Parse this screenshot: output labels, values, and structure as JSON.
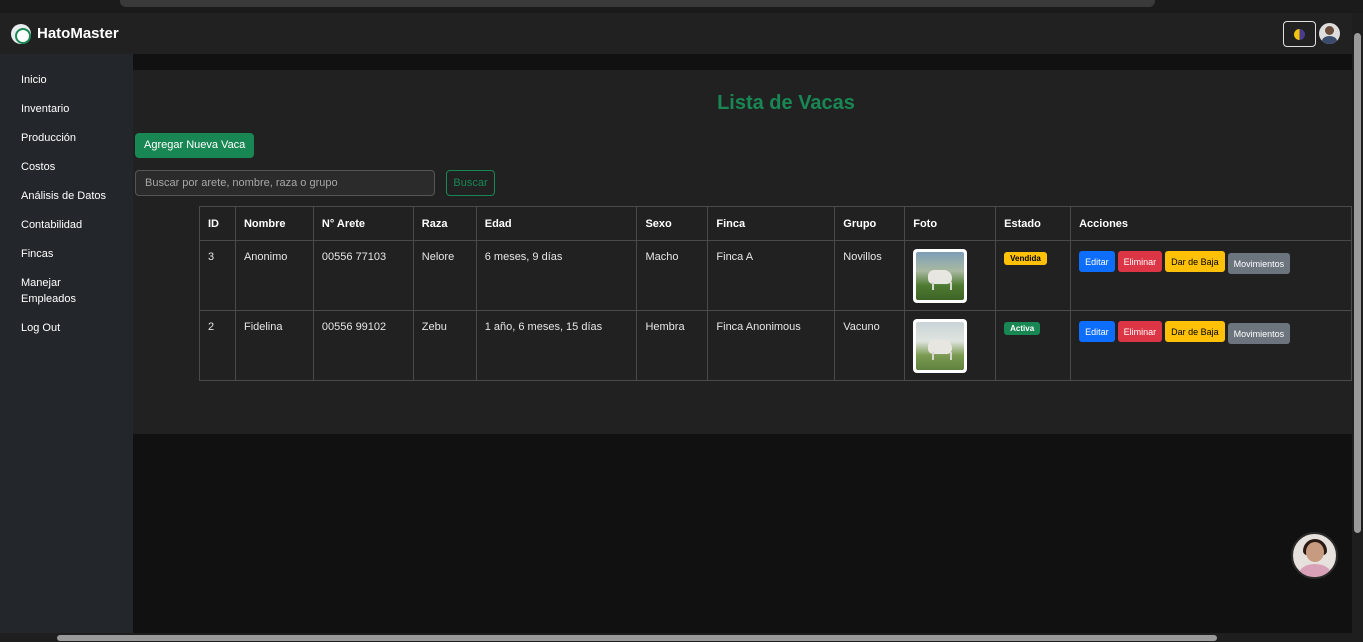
{
  "app": {
    "name": "HatoMaster",
    "accent": "#198754"
  },
  "sidebar": {
    "items": [
      {
        "label": "Inicio"
      },
      {
        "label": "Inventario"
      },
      {
        "label": "Producción"
      },
      {
        "label": "Costos"
      },
      {
        "label": "Análisis de Datos"
      },
      {
        "label": "Contabilidad"
      },
      {
        "label": "Fincas"
      },
      {
        "label": "Manejar Empleados"
      },
      {
        "label": "Log Out"
      }
    ]
  },
  "main": {
    "title": "Lista de Vacas",
    "add_button": "Agregar Nueva Vaca",
    "search": {
      "placeholder": "Buscar por arete, nombre, raza o grupo",
      "value": "",
      "button": "Buscar"
    }
  },
  "table": {
    "headers": [
      "ID",
      "Nombre",
      "N° Arete",
      "Raza",
      "Edad",
      "Sexo",
      "Finca",
      "Grupo",
      "Foto",
      "Estado",
      "Acciones"
    ],
    "rows": [
      {
        "id": "3",
        "nombre": "Anonimo",
        "arete": "00556 77103",
        "raza": "Nelore",
        "edad": "6 meses, 9 días",
        "sexo": "Macho",
        "finca": "Finca A",
        "grupo": "Novillos",
        "estado": "Vendida"
      },
      {
        "id": "2",
        "nombre": "Fidelina",
        "arete": "00556 99102",
        "raza": "Zebu",
        "edad": "1 año, 6 meses, 15 días",
        "sexo": "Hembra",
        "finca": "Finca Anonimous",
        "grupo": "Vacuno",
        "estado": "Activa"
      }
    ],
    "actions": {
      "edit": "Editar",
      "delete": "Eliminar",
      "retire": "Dar de Baja",
      "movements": "Movimientos"
    }
  },
  "colors": {
    "edit": "#0d6efd",
    "delete": "#dc3545",
    "retire": "#ffc107",
    "movements": "#6c757d",
    "badge_sold": "#ffc107",
    "badge_active": "#198754"
  },
  "icons": {
    "brand": "herd-logo-icon",
    "theme": "theme-toggle-icon",
    "user": "user-avatar",
    "chat": "assistant-avatar"
  }
}
